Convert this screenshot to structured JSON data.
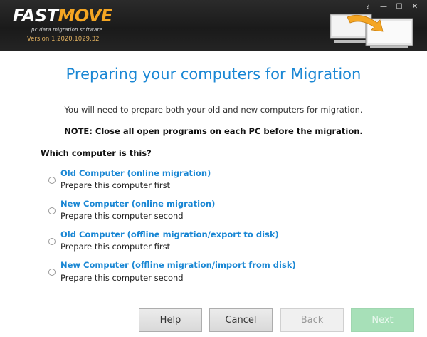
{
  "header": {
    "logo_part1": "FAST",
    "logo_part2": "MOVE",
    "tagline": "pc data migration software",
    "version": "Version 1.2020.1029.32",
    "controls": {
      "help": "?",
      "minimize": "—",
      "maximize": "☐",
      "close": "✕"
    }
  },
  "main": {
    "title": "Preparing your computers for Migration",
    "subtitle": "You will need to prepare both your old and new computers for migration.",
    "note": "NOTE: Close all open programs on each PC before the migration.",
    "question": "Which computer is this?",
    "options": [
      {
        "title": "Old Computer (online migration)",
        "desc": "Prepare this computer first"
      },
      {
        "title": "New Computer (online migration)",
        "desc": "Prepare this computer second"
      },
      {
        "title": "Old Computer (offline migration/export to disk)",
        "desc": "Prepare this computer first"
      },
      {
        "title": "New Computer (offline migration/import from disk)",
        "desc": "Prepare this computer second"
      }
    ]
  },
  "buttons": {
    "help": "Help",
    "cancel": "Cancel",
    "back": "Back",
    "next": "Next"
  },
  "colors": {
    "accent_blue": "#1a87d4",
    "brand_orange": "#f5a623",
    "next_disabled_green": "#a7e0b8"
  }
}
